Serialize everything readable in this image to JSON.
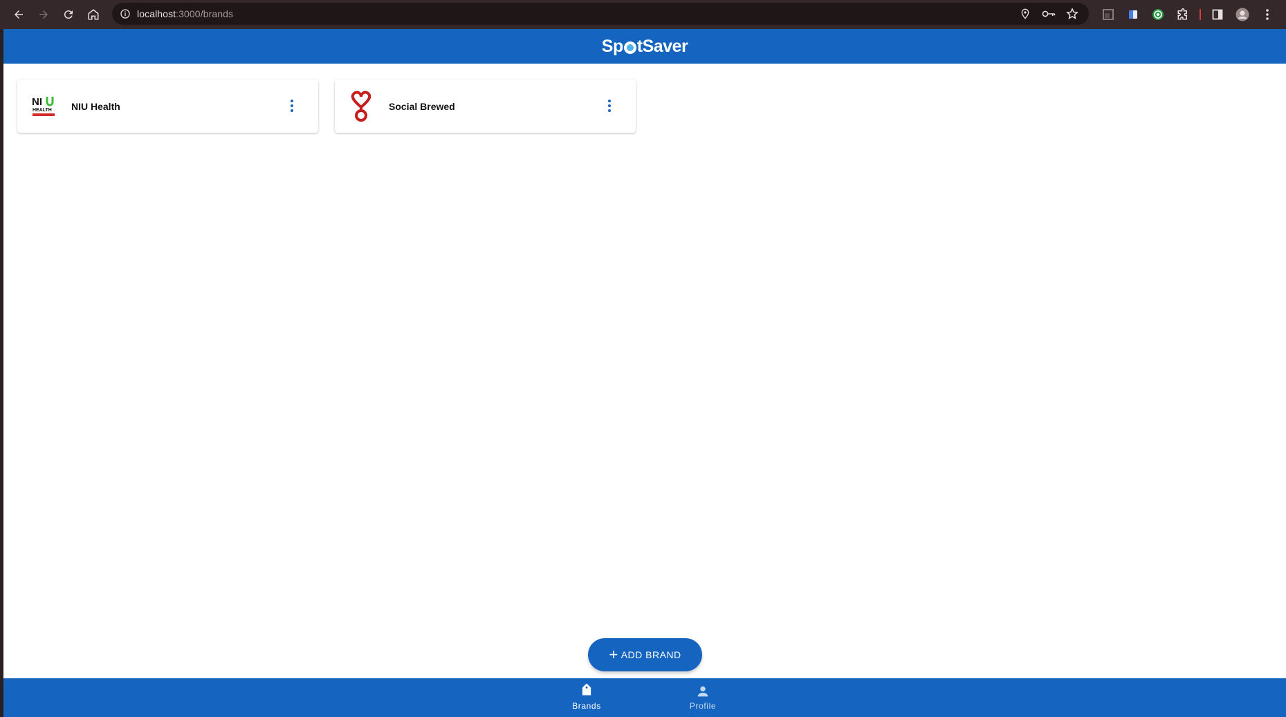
{
  "browser": {
    "url_host": "localhost",
    "url_path": ":3000/brands"
  },
  "app": {
    "logo_left": "Sp",
    "logo_right": "tSaver"
  },
  "brands": [
    {
      "name": "NIU Health",
      "logo_icon": "niu-health-logo"
    },
    {
      "name": "Social Brewed",
      "logo_icon": "social-brewed-logo"
    }
  ],
  "fab": {
    "label": "ADD BRAND"
  },
  "bottom_nav": {
    "items": [
      {
        "label": "Brands",
        "icon": "tag-icon",
        "active": true
      },
      {
        "label": "Profile",
        "icon": "person-icon",
        "active": false
      }
    ]
  },
  "colors": {
    "primary": "#1565c0",
    "chrome": "#35282a",
    "social_red": "#c41e1e",
    "niu_green": "#3dbb3d"
  }
}
